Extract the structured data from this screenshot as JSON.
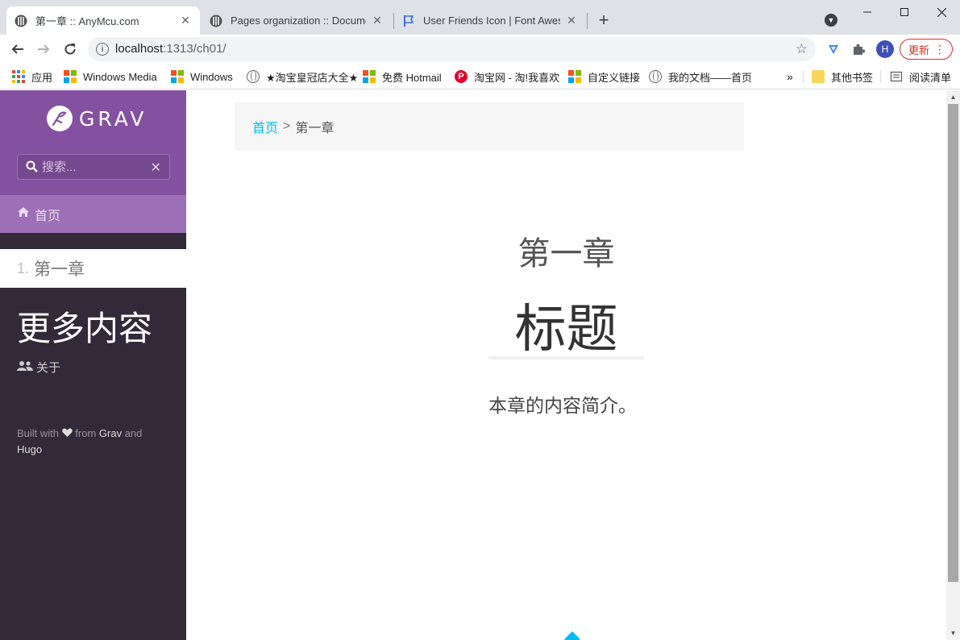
{
  "browser": {
    "tabs": [
      {
        "title": "第一章 :: AnyMcu.com",
        "active": true
      },
      {
        "title": "Pages organization :: Documentation",
        "active": false
      },
      {
        "title": "User Friends Icon | Font Awesome",
        "active": false
      }
    ],
    "address": {
      "host": "localhost",
      "rest": ":1313/ch01/"
    },
    "profile_initial": "H",
    "update_label": "更新"
  },
  "bookmarks": [
    {
      "label": "应用",
      "icon": "apps-icon"
    },
    {
      "label": "Windows Media",
      "icon": "windows-icon"
    },
    {
      "label": "Windows",
      "icon": "windows-icon"
    },
    {
      "label": "★淘宝皇冠店大全★",
      "icon": "globe-icon"
    },
    {
      "label": "免费 Hotmail",
      "icon": "windows-icon"
    },
    {
      "label": "淘宝网 - 淘!我喜欢",
      "icon": "taobao-icon"
    },
    {
      "label": "自定义链接",
      "icon": "windows-icon"
    },
    {
      "label": "我的文档——首页",
      "icon": "globe-icon"
    },
    {
      "label": "其他书签",
      "icon": "folder-icon"
    },
    {
      "label": "阅读清单",
      "icon": "reading-list-icon"
    }
  ],
  "sidebar": {
    "logo_text": "GRAV",
    "search_placeholder": "搜索...",
    "home_label": "首页",
    "chapter_number": "1.",
    "chapter_label": "第一章",
    "more_heading": "更多内容",
    "about_label": "关于",
    "footer": {
      "built": "Built with",
      "from": "from",
      "grav": "Grav",
      "and": "and",
      "hugo": "Hugo"
    }
  },
  "main": {
    "breadcrumb": {
      "home": "首页",
      "separator": ">",
      "current": "第一章"
    },
    "subtitle": "第一章",
    "title": "标题",
    "intro": "本章的内容简介。"
  },
  "colors": {
    "sidebar_header": "#8451a1",
    "sidebar_active": "#9c6fb6",
    "sidebar_bg": "#322a38",
    "link": "#00bdf3"
  }
}
